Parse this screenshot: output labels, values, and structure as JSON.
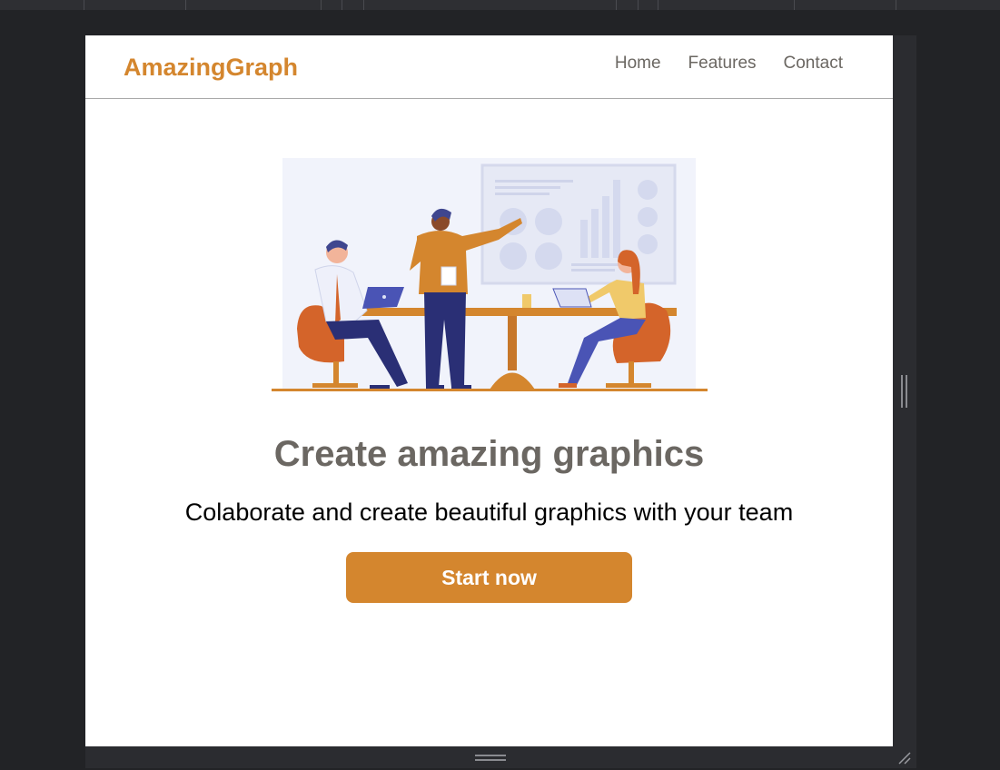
{
  "navbar": {
    "brand": "AmazingGraph",
    "links": [
      {
        "label": "Home"
      },
      {
        "label": "Features"
      },
      {
        "label": "Contact"
      }
    ]
  },
  "hero": {
    "title": "Create amazing graphics",
    "subtitle": "Colaborate and create beautiful graphics with your team",
    "cta_label": "Start now"
  },
  "colors": {
    "accent": "#d4862e",
    "text_muted": "#6b6762",
    "divider": "#a9a9a9",
    "window_bg": "#222326"
  }
}
